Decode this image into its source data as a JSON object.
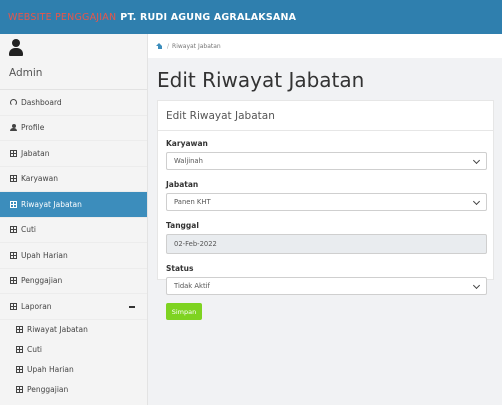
{
  "topbar": {
    "title_part1": "WEBSITE PENGGAJIAN",
    "title_part2": "PT. RUDI AGUNG AGRALAKSANA"
  },
  "sidebar": {
    "user_name": "Admin",
    "items": [
      {
        "label": "Dashboard",
        "icon": "dashboard-icon"
      },
      {
        "label": "Profile",
        "icon": "user-icon"
      },
      {
        "label": "Jabatan",
        "icon": "table-icon"
      },
      {
        "label": "Karyawan",
        "icon": "table-icon"
      },
      {
        "label": "Riwayat Jabatan",
        "icon": "table-icon",
        "active": true
      },
      {
        "label": "Cuti",
        "icon": "table-icon"
      },
      {
        "label": "Upah Harian",
        "icon": "table-icon"
      },
      {
        "label": "Penggajian",
        "icon": "table-icon"
      },
      {
        "label": "Laporan",
        "icon": "table-icon",
        "expanded": true
      }
    ],
    "subitems": [
      {
        "label": "Riwayat Jabatan",
        "icon": "table-icon"
      },
      {
        "label": "Cuti",
        "icon": "table-icon"
      },
      {
        "label": "Upah Harian",
        "icon": "table-icon"
      },
      {
        "label": "Penggajian",
        "icon": "table-icon"
      }
    ]
  },
  "breadcrumb": {
    "label": "Riwayat Jabatan"
  },
  "page": {
    "title": "Edit Riwayat Jabatan"
  },
  "form": {
    "header": "Edit Riwayat Jabatan",
    "karyawan_label": "Karyawan",
    "karyawan_value": "Waljinah",
    "jabatan_label": "Jabatan",
    "jabatan_value": "Panen KHT",
    "tanggal_label": "Tanggal",
    "tanggal_value": "02-Feb-2022",
    "status_label": "Status",
    "status_value": "Tidak Aktif",
    "submit_label": "Simpan"
  },
  "colors": {
    "topbar": "#2f7fae",
    "title_accent": "#e8564a",
    "active_menu": "#3c8dbc",
    "submit_button": "#7ed321"
  }
}
